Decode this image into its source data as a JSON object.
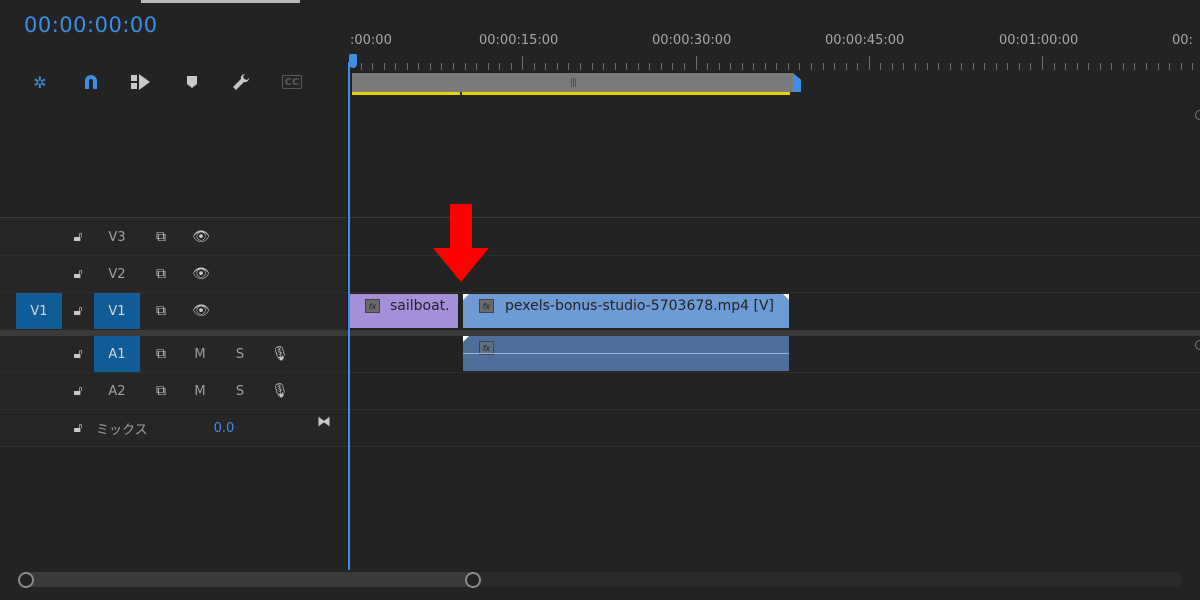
{
  "sequence": {
    "timecode": "00:00:00:00"
  },
  "toolbar": {
    "items": [
      {
        "name": "insert-overwrite-icon",
        "glyph": "✲"
      },
      {
        "name": "snap-magnet-icon",
        "glyph": "∩"
      },
      {
        "name": "linked-selection-icon",
        "glyph": "⧓"
      },
      {
        "name": "add-marker-icon",
        "glyph": "⬟"
      },
      {
        "name": "wrench-settings-icon",
        "glyph": "🔧"
      },
      {
        "name": "captions-icon",
        "glyph": "CC"
      }
    ]
  },
  "ruler": {
    "labels": [
      ":00:00",
      "00:00:15:00",
      "00:00:30:00",
      "00:00:45:00",
      "00:01:00:00",
      "00:"
    ]
  },
  "tracks": {
    "video": [
      {
        "name": "V3",
        "source": ""
      },
      {
        "name": "V2",
        "source": ""
      },
      {
        "name": "V1",
        "source": "V1"
      }
    ],
    "audio": [
      {
        "name": "A1",
        "mute": "M",
        "solo": "S"
      },
      {
        "name": "A2",
        "mute": "M",
        "solo": "S"
      }
    ],
    "mix": {
      "label": "ミックス",
      "value": "0.0"
    }
  },
  "clips": {
    "video1": [
      {
        "label": "sailboat.",
        "color": "#a58fd9"
      },
      {
        "label": "pexels-bonus-studio-5703678.mp4 [V]",
        "color": "#6e9ad6"
      }
    ],
    "audio1": [
      {
        "label": "",
        "color": "#4e6f9a"
      }
    ]
  },
  "colors": {
    "accent": "#3d8ee6",
    "selected_track": "#0f5c96",
    "arrow": "#ff0000",
    "workarea_bar": "#e6d300"
  }
}
